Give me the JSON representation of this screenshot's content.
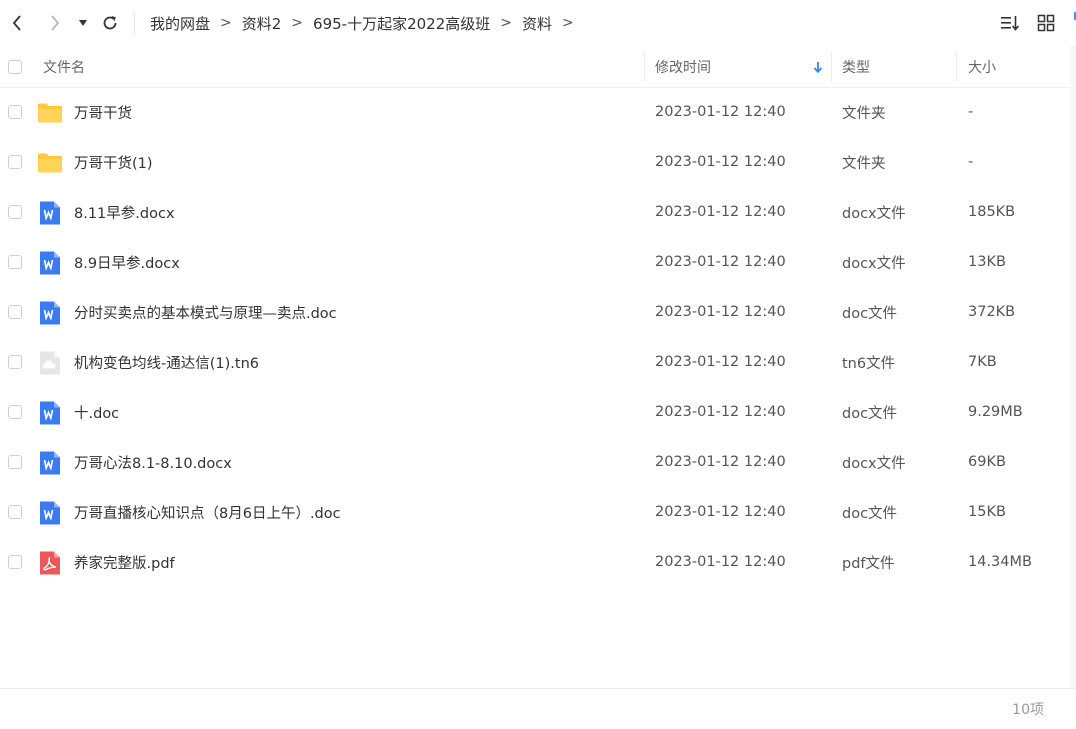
{
  "breadcrumb": [
    {
      "label": "我的网盘"
    },
    {
      "label": "资料2"
    },
    {
      "label": "695-十万起家2022高级班"
    },
    {
      "label": "资料"
    }
  ],
  "breadcrumb_separator": ">",
  "columns": {
    "name": "文件名",
    "modified": "修改时间",
    "type": "类型",
    "size": "大小"
  },
  "sort": {
    "column": "modified",
    "direction": "desc"
  },
  "files": [
    {
      "name": "万哥干货",
      "modified": "2023-01-12 12:40",
      "type": "文件夹",
      "size": "-",
      "icon": "folder-icon"
    },
    {
      "name": "万哥干货(1)",
      "modified": "2023-01-12 12:40",
      "type": "文件夹",
      "size": "-",
      "icon": "folder-icon"
    },
    {
      "name": "8.11早参.docx",
      "modified": "2023-01-12 12:40",
      "type": "docx文件",
      "size": "185KB",
      "icon": "word-doc-icon"
    },
    {
      "name": "8.9日早参.docx",
      "modified": "2023-01-12 12:40",
      "type": "docx文件",
      "size": "13KB",
      "icon": "word-doc-icon"
    },
    {
      "name": "分时买卖点的基本模式与原理—卖点.doc",
      "modified": "2023-01-12 12:40",
      "type": "doc文件",
      "size": "372KB",
      "icon": "word-doc-icon"
    },
    {
      "name": "机构变色均线-通达信(1).tn6",
      "modified": "2023-01-12 12:40",
      "type": "tn6文件",
      "size": "7KB",
      "icon": "cloud-file-icon"
    },
    {
      "name": "十.doc",
      "modified": "2023-01-12 12:40",
      "type": "doc文件",
      "size": "9.29MB",
      "icon": "word-doc-icon"
    },
    {
      "name": "万哥心法8.1-8.10.docx",
      "modified": "2023-01-12 12:40",
      "type": "docx文件",
      "size": "69KB",
      "icon": "word-doc-icon"
    },
    {
      "name": "万哥直播核心知识点（8月6日上午）.doc",
      "modified": "2023-01-12 12:40",
      "type": "doc文件",
      "size": "15KB",
      "icon": "word-doc-icon"
    },
    {
      "name": "养家完整版.pdf",
      "modified": "2023-01-12 12:40",
      "type": "pdf文件",
      "size": "14.34MB",
      "icon": "pdf-icon"
    }
  ],
  "status": {
    "count": "10项"
  },
  "colors": {
    "folder": "#FFC83D",
    "word": "#3B7BF0",
    "pdf": "#F0555A",
    "cloud": "#D9D9D9",
    "sort_arrow": "#2A8CE8"
  }
}
